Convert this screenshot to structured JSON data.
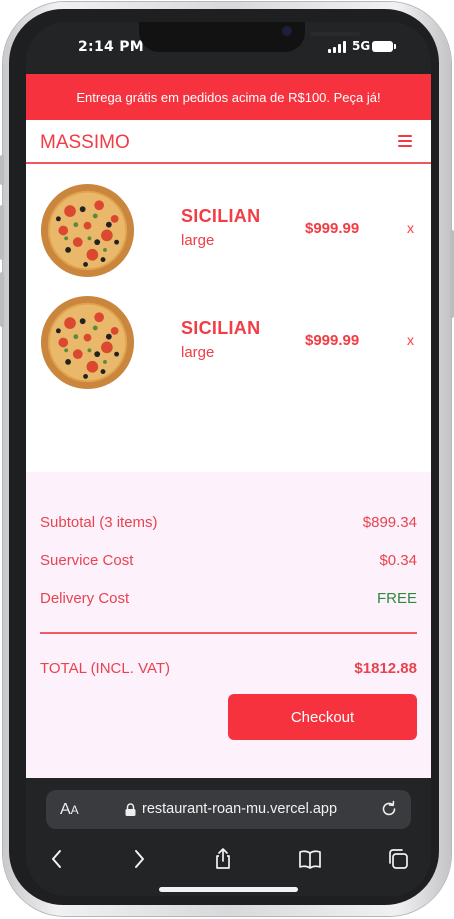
{
  "status_bar": {
    "time": "2:14 PM",
    "network": "5G"
  },
  "promo": {
    "text": "Entrega grátis em pedidos acima de R$100. Peça já!"
  },
  "header": {
    "brand": "MASSIMO"
  },
  "cart": {
    "items": [
      {
        "name": "SICILIAN",
        "size": "large",
        "price": "$999.99",
        "remove": "x"
      },
      {
        "name": "SICILIAN",
        "size": "large",
        "price": "$999.99",
        "remove": "x"
      }
    ]
  },
  "summary": {
    "subtotal_label": "Subtotal (3 items)",
    "subtotal_value": "$899.34",
    "service_label": "Suervice Cost",
    "service_value": "$0.34",
    "delivery_label": "Delivery Cost",
    "delivery_value": "FREE",
    "total_label": "TOTAL (INCL. VAT)",
    "total_value": "$1812.88",
    "checkout_label": "Checkout"
  },
  "browser": {
    "aa_label": "A",
    "aa_small": "A",
    "url": "restaurant-roan-mu.vercel.app"
  },
  "colors": {
    "brand_red": "#f6323f",
    "text_red": "#f23c46",
    "summary_bg": "#fdf2fc",
    "free_green": "#2c8a3d"
  },
  "icons": [
    "menu-icon",
    "lock-icon",
    "reload-icon",
    "back-icon",
    "forward-icon",
    "share-icon",
    "bookmarks-icon",
    "tabs-icon"
  ]
}
